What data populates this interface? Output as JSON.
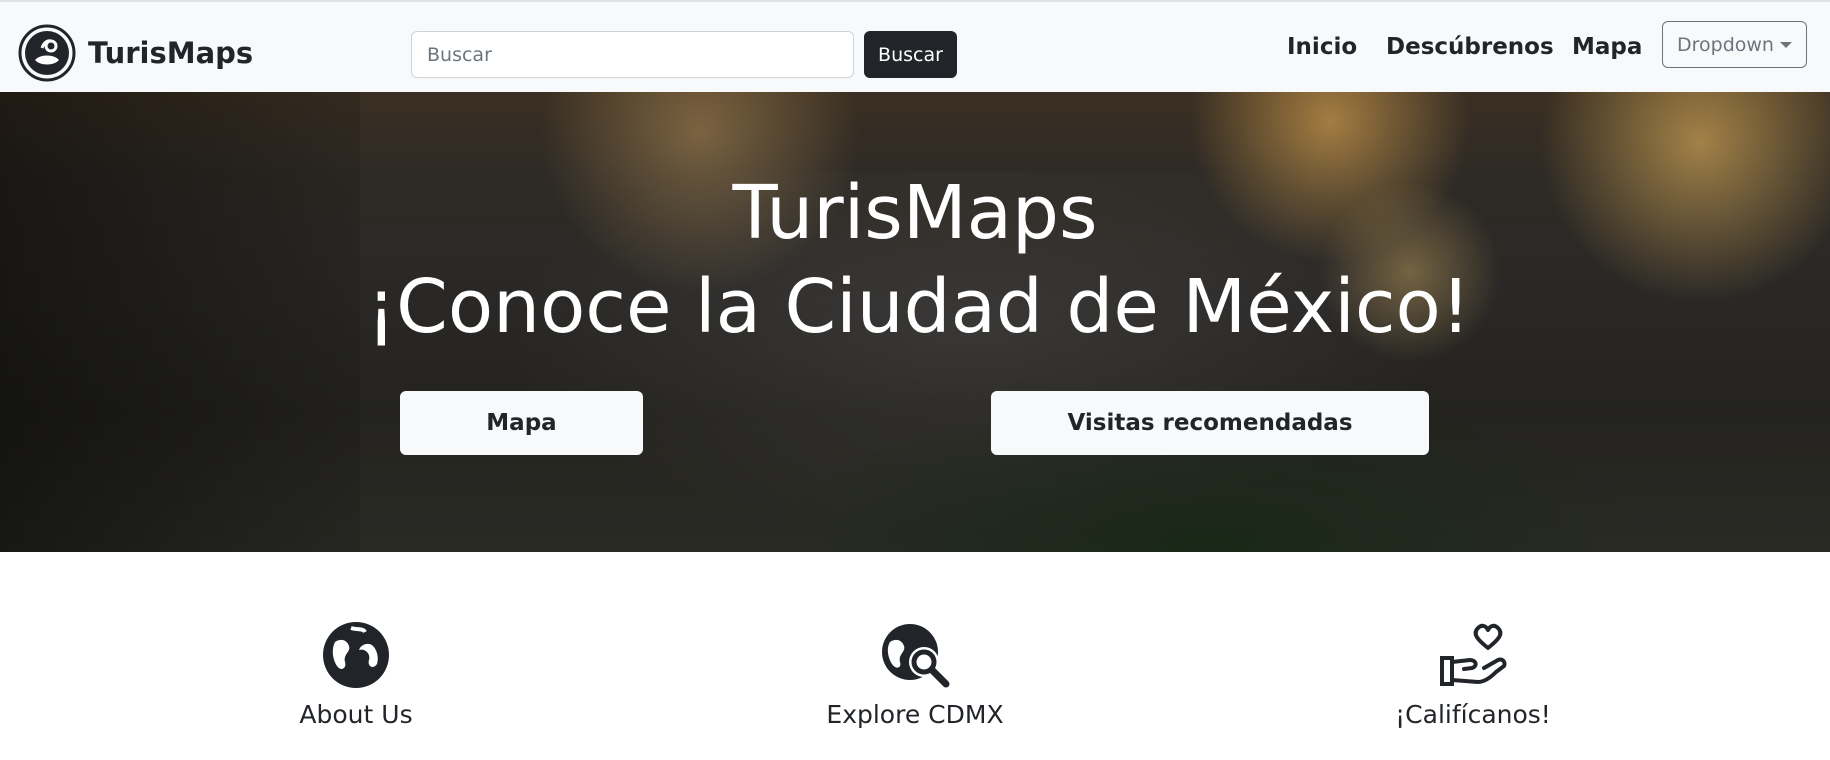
{
  "navbar": {
    "brand": "TurisMaps",
    "search": {
      "placeholder": "Buscar",
      "value": ""
    },
    "search_button": "Buscar",
    "links": [
      "Inicio",
      "Descúbrenos",
      "Mapa"
    ],
    "dropdown": "Dropdown"
  },
  "hero": {
    "title_line1": "TurisMaps",
    "title_line2": "¡Conoce la Ciudad de México!",
    "buttons": [
      "Mapa",
      "Visitas recomendadas"
    ]
  },
  "features": [
    {
      "icon": "globe-icon",
      "title": "About Us"
    },
    {
      "icon": "globe-search-icon",
      "title": "Explore CDMX"
    },
    {
      "icon": "hand-heart-icon",
      "title": "¡Califícanos!"
    }
  ],
  "colors": {
    "dark": "#212529",
    "light": "#f8f9fa",
    "muted": "#6c757d"
  }
}
